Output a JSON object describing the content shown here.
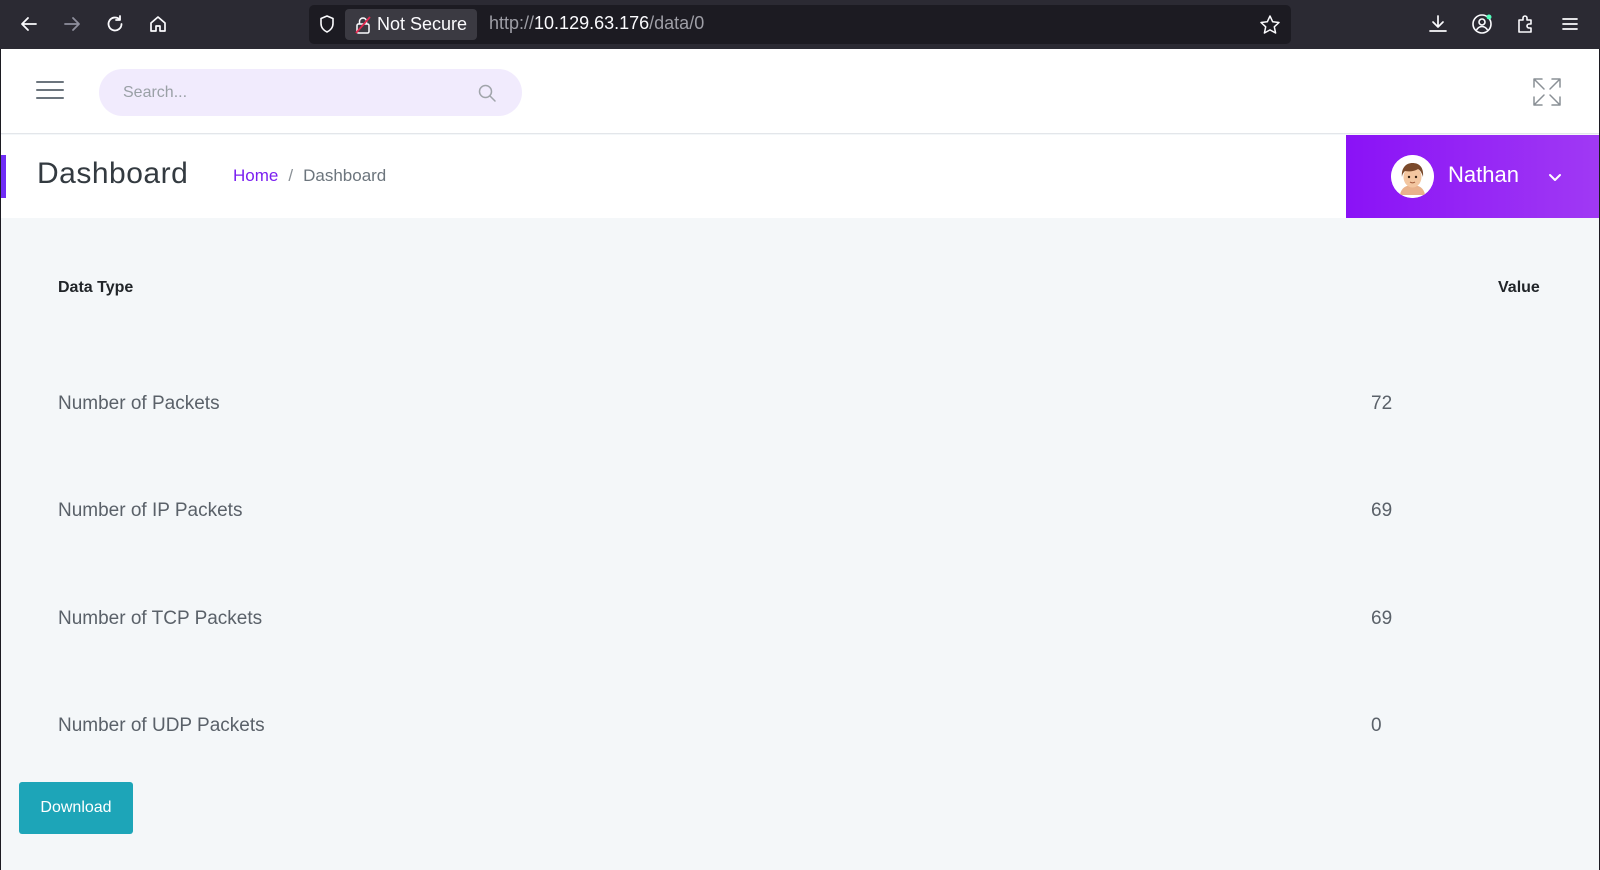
{
  "browser": {
    "security_label": "Not Secure",
    "url_prefix": "http://",
    "url_host": "10.129.63.176",
    "url_path": "/data/0"
  },
  "topbar": {
    "search_placeholder": "Search..."
  },
  "header": {
    "title": "Dashboard",
    "breadcrumb_home": "Home",
    "breadcrumb_separator": "/",
    "breadcrumb_current": "Dashboard",
    "user_name": "Nathan"
  },
  "table": {
    "headers": [
      "Data Type",
      "Value"
    ],
    "rows": [
      {
        "label": "Number of Packets",
        "value": "72"
      },
      {
        "label": "Number of IP Packets",
        "value": "69"
      },
      {
        "label": "Number of TCP Packets",
        "value": "69"
      },
      {
        "label": "Number of UDP Packets",
        "value": "0"
      }
    ]
  },
  "actions": {
    "download_label": "Download"
  },
  "colors": {
    "accent": "#7a1ff0",
    "user_box": "#9427f5",
    "download": "#1da5b8"
  }
}
